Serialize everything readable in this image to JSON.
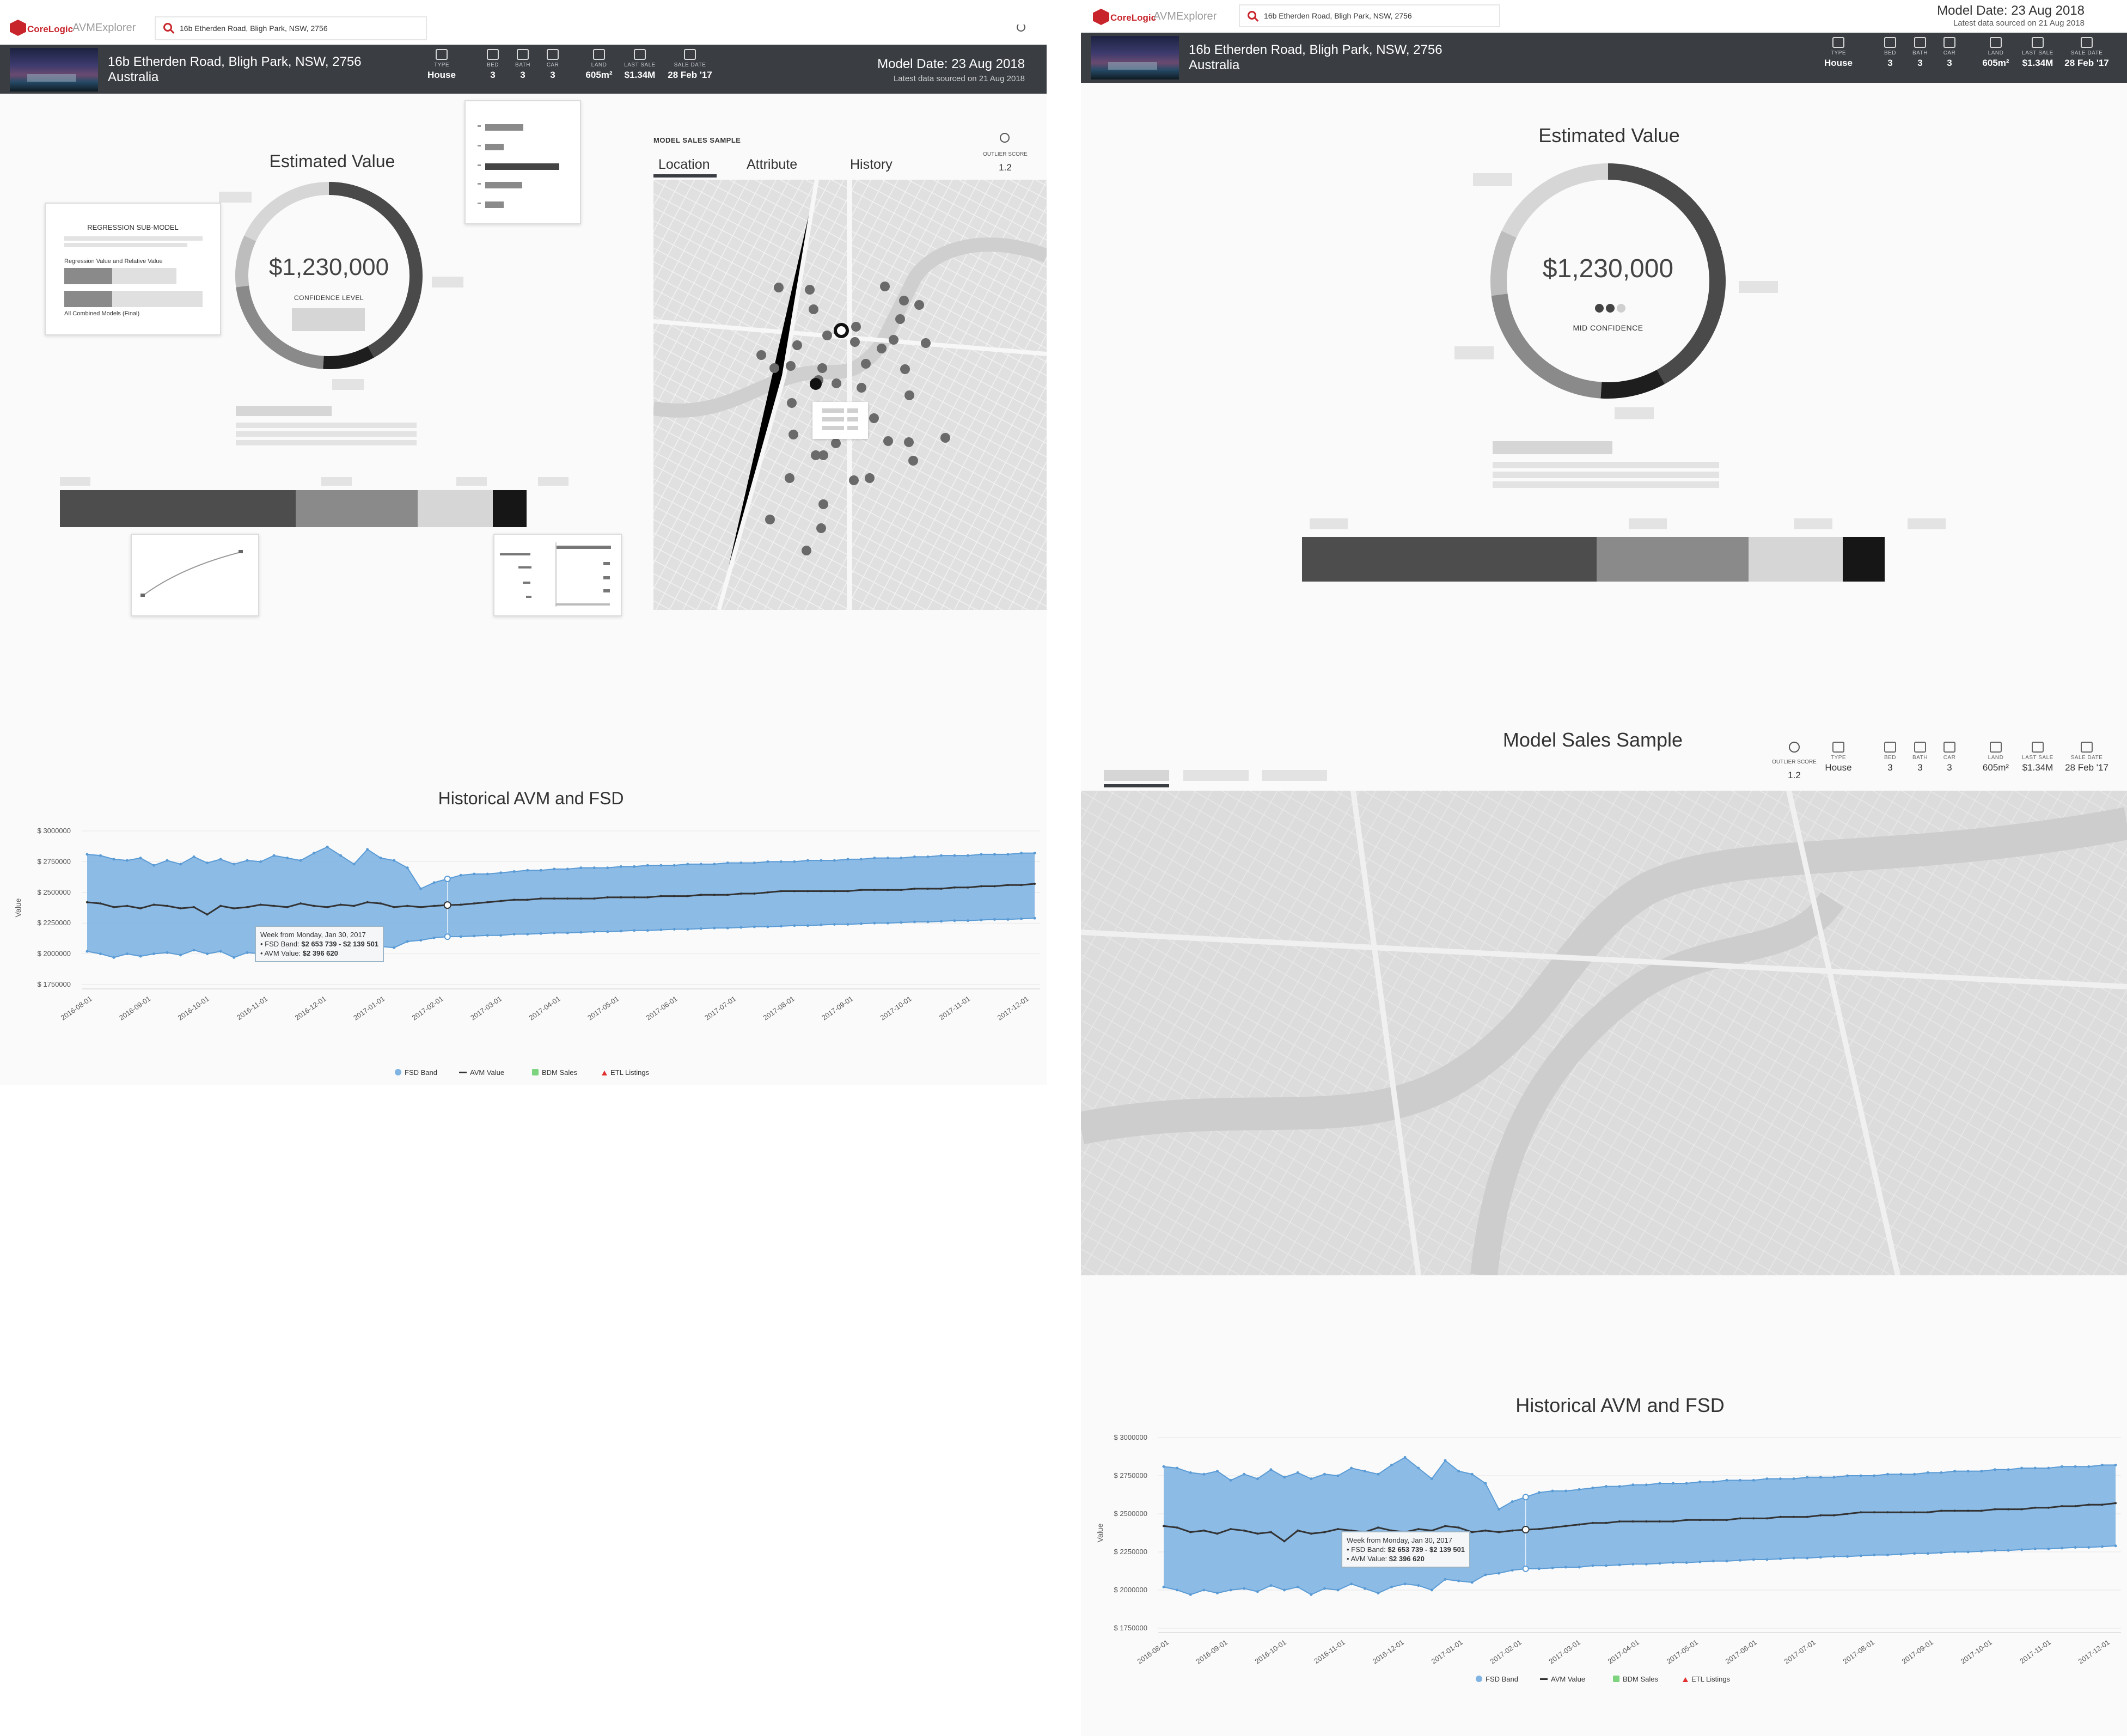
{
  "app": {
    "brand": "CoreLogic",
    "name": "AVMExplorer"
  },
  "search": {
    "value": "16b Etherden Road, Bligh Park, NSW, 2756"
  },
  "property": {
    "address_line1": "16b Etherden Road, Bligh Park, NSW, 2756",
    "address_line2": "Australia",
    "stats": [
      {
        "label": "TYPE",
        "value": "House",
        "icon": "house-icon"
      },
      {
        "label": "BED",
        "value": "3",
        "icon": "bed-icon"
      },
      {
        "label": "BATH",
        "value": "3",
        "icon": "bath-icon"
      },
      {
        "label": "CAR",
        "value": "3",
        "icon": "car-icon"
      },
      {
        "label": "LAND",
        "value": "605m²",
        "icon": "land-icon"
      },
      {
        "label": "LAST SALE",
        "value": "$1.34M",
        "icon": "price-tag-icon"
      },
      {
        "label": "SALE DATE",
        "value": "28 Feb '17",
        "icon": "calendar-icon"
      }
    ]
  },
  "model": {
    "date": "Model Date: 23 Aug 2018",
    "latest": "Latest data sourced on 21 Aug 2018"
  },
  "estimate": {
    "title": "Estimated Value",
    "value": "$1,230,000",
    "confidence_a": "CONFIDENCE LEVEL",
    "confidence_b": "MID CONFIDENCE",
    "ring_segments": [
      0.42,
      0.09,
      0.22,
      0.09
    ]
  },
  "regression_popover": {
    "title": "REGRESSION SUB-MODEL",
    "row1": "Regression Value and Relative Value",
    "row2": "All Combined Models (Final)"
  },
  "range_bar": {
    "segments": [
      0.455,
      0.235,
      0.145,
      0.065
    ]
  },
  "model_sales": {
    "title_small": "MODEL SALES SAMPLE",
    "title_large": "Model Sales Sample",
    "tabs": [
      "Location",
      "Attribute",
      "History"
    ],
    "outlier_label": "OUTLIER SCORE",
    "outlier_value": "1.2"
  },
  "history_chart_title": "Historical AVM and FSD",
  "tooltip": {
    "line1": "Week from Monday, Jan 30, 2017",
    "line2_label": "• FSD Band: ",
    "line2_value": "$2 653 739 - $2 139 501",
    "line3_label": "• AVM Value: ",
    "line3_value": "$2 396 620"
  },
  "chart_data": {
    "type": "area",
    "title": "Historical AVM and FSD",
    "ylabel": "Value",
    "ylim": [
      1750000,
      3000000
    ],
    "y_ticks": [
      "$ 1750000",
      "$ 2000000",
      "$ 2250000",
      "$ 2500000",
      "$ 2750000",
      "$ 3000000"
    ],
    "y_tick_values": [
      1750000,
      2000000,
      2250000,
      2500000,
      2750000,
      3000000
    ],
    "x_ticks": [
      "2016-08-01",
      "2016-09-01",
      "2016-10-01",
      "2016-11-01",
      "2016-12-01",
      "2017-01-01",
      "2017-02-01",
      "2017-03-01",
      "2017-04-01",
      "2017-05-01",
      "2017-06-01",
      "2017-07-01",
      "2017-08-01",
      "2017-09-01",
      "2017-10-01",
      "2017-11-01",
      "2017-12-01"
    ],
    "series": [
      {
        "name": "FSD Band",
        "type": "band",
        "upper": [
          2810000,
          2800000,
          2770000,
          2760000,
          2780000,
          2720000,
          2760000,
          2730000,
          2790000,
          2740000,
          2770000,
          2730000,
          2760000,
          2750000,
          2800000,
          2780000,
          2760000,
          2820000,
          2870000,
          2800000,
          2730000,
          2850000,
          2780000,
          2760000,
          2700000,
          2530000,
          2580000,
          2610000,
          2640000,
          2650000,
          2650000,
          2660000,
          2670000,
          2680000,
          2680000,
          2690000,
          2690000,
          2700000,
          2700000,
          2700000,
          2710000,
          2710000,
          2720000,
          2720000,
          2720000,
          2730000,
          2730000,
          2730000,
          2740000,
          2740000,
          2740000,
          2750000,
          2750000,
          2750000,
          2760000,
          2760000,
          2760000,
          2770000,
          2770000,
          2780000,
          2780000,
          2780000,
          2790000,
          2790000,
          2800000,
          2800000,
          2800000,
          2810000,
          2810000,
          2810000,
          2820000,
          2820000
        ],
        "lower": [
          2020000,
          2000000,
          1970000,
          2000000,
          1980000,
          2000000,
          2010000,
          1990000,
          2030000,
          2000000,
          2020000,
          1970000,
          2010000,
          2000000,
          2040000,
          2010000,
          1980000,
          2020000,
          2040000,
          2030000,
          2000000,
          2070000,
          2060000,
          2050000,
          2100000,
          2110000,
          2130000,
          2139501,
          2140000,
          2145000,
          2150000,
          2150000,
          2160000,
          2160000,
          2165000,
          2170000,
          2170000,
          2175000,
          2180000,
          2180000,
          2185000,
          2190000,
          2190000,
          2195000,
          2200000,
          2200000,
          2205000,
          2210000,
          2210000,
          2215000,
          2220000,
          2220000,
          2225000,
          2230000,
          2230000,
          2235000,
          2240000,
          2240000,
          2245000,
          2250000,
          2250000,
          2255000,
          2260000,
          2260000,
          2265000,
          2270000,
          2270000,
          2275000,
          2280000,
          2280000,
          2285000,
          2290000
        ]
      },
      {
        "name": "AVM Value",
        "type": "line",
        "values": [
          2420000,
          2410000,
          2380000,
          2390000,
          2370000,
          2400000,
          2390000,
          2370000,
          2380000,
          2320000,
          2390000,
          2370000,
          2380000,
          2400000,
          2390000,
          2380000,
          2410000,
          2390000,
          2380000,
          2400000,
          2390000,
          2420000,
          2410000,
          2380000,
          2390000,
          2380000,
          2390000,
          2396620,
          2400000,
          2410000,
          2420000,
          2430000,
          2440000,
          2440000,
          2450000,
          2450000,
          2450000,
          2450000,
          2450000,
          2460000,
          2460000,
          2460000,
          2460000,
          2470000,
          2470000,
          2470000,
          2480000,
          2480000,
          2480000,
          2490000,
          2490000,
          2500000,
          2510000,
          2510000,
          2510000,
          2510000,
          2510000,
          2510000,
          2520000,
          2520000,
          2520000,
          2520000,
          2530000,
          2530000,
          2530000,
          2540000,
          2540000,
          2550000,
          2550000,
          2560000,
          2560000,
          2570000
        ]
      }
    ],
    "legend": [
      "FSD Band",
      "AVM Value",
      "BDM Sales",
      "ETL Listings"
    ],
    "colors": {
      "band": "#7fb4e3",
      "band_line": "#5a9bd5",
      "avm": "#333333",
      "bdm": "#7ed37e",
      "etl": "#e03030"
    }
  }
}
